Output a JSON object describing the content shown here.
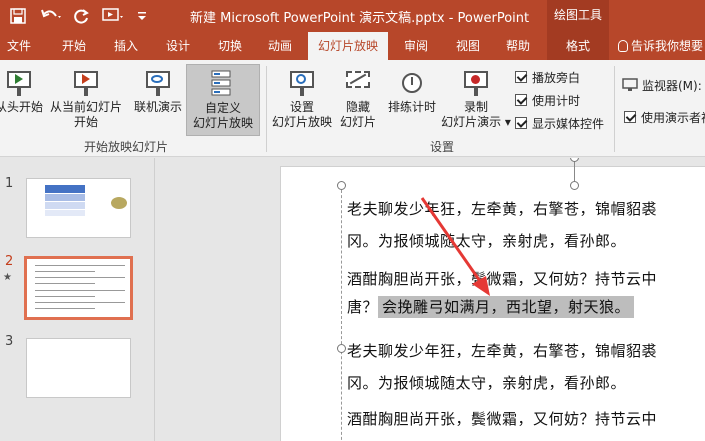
{
  "titlebar": {
    "title": "新建 Microsoft PowerPoint 演示文稿.pptx  -  PowerPoint",
    "contextual_title": "绘图工具",
    "bg_color": "#b7472a"
  },
  "tabs": [
    {
      "label": "文件"
    },
    {
      "label": "开始"
    },
    {
      "label": "插入"
    },
    {
      "label": "设计"
    },
    {
      "label": "切换"
    },
    {
      "label": "动画"
    },
    {
      "label": "幻灯片放映",
      "active": true
    },
    {
      "label": "审阅"
    },
    {
      "label": "视图"
    },
    {
      "label": "帮助"
    },
    {
      "label": "格式",
      "contextual": true
    }
  ],
  "tell_me": "告诉我你想要",
  "ribbon": {
    "start_group": {
      "label": "开始放映幻灯片",
      "from_beginning": "从头开始",
      "from_current_1": "从当前幻灯片",
      "from_current_2": "开始",
      "online_1": "联机演示",
      "custom_1": "自定义",
      "custom_2": "幻灯片放映"
    },
    "setup_group": {
      "label": "设置",
      "setup_1": "设置",
      "setup_2": "幻灯片放映",
      "hide_1": "隐藏",
      "hide_2": "幻灯片",
      "rehearse": "排练计时",
      "record_1": "录制",
      "record_2": "幻灯片演示",
      "checkboxes": [
        "播放旁白",
        "使用计时",
        "显示媒体控件"
      ]
    },
    "monitor_group": {
      "monitor": "监视器(M):",
      "presenter_view": "使用演示者视"
    }
  },
  "thumbnails": [
    {
      "number": "1"
    },
    {
      "number": "2",
      "selected": true,
      "star": "★"
    },
    {
      "number": "3"
    }
  ],
  "slide_text": {
    "line1": "老夫聊发少年狂，左牵黄，右擎苍，锦帽貂裘",
    "line2": "冈。为报倾城随太守，亲射虎，看孙郎。",
    "line3": "酒酣胸胆尚开张，鬓微霜，又何妨？持节云中",
    "line4_pre": "唐？",
    "line4_selected": "会挽雕弓如满月，西北望，射天狼。",
    "line5": "老夫聊发少年狂，左牵黄，右擎苍，锦帽貂裘",
    "line6": "冈。为报倾城随太守，亲射虎，看孙郎。",
    "line7": "酒酣胸胆尚开张，鬓微霜，又何妨？持节云中"
  },
  "annotation_arrow_color": "#e53935"
}
